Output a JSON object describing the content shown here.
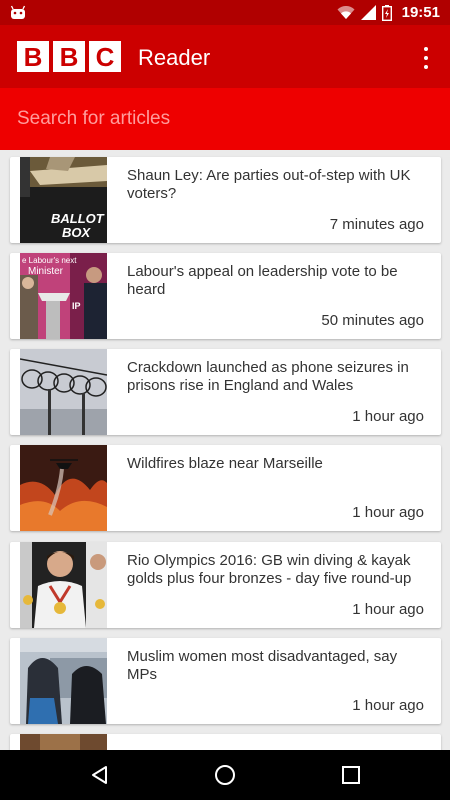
{
  "status_bar": {
    "time": "19:51",
    "icons": [
      "android-icon",
      "wifi-icon",
      "signal-icon",
      "battery-icon"
    ]
  },
  "app_bar": {
    "logo_letters": [
      "B",
      "B",
      "C"
    ],
    "title": "Reader",
    "menu_icon": "overflow-menu-icon"
  },
  "search": {
    "placeholder": "Search for articles",
    "value": ""
  },
  "articles": [
    {
      "headline": "Shaun Ley: Are parties out-of-step with UK voters?",
      "time": "7 minutes ago",
      "thumb_text": "BALLOT BOX"
    },
    {
      "headline": "Labour's appeal on leadership vote to be heard",
      "time": "50 minutes ago",
      "thumb_text": "e Labour's next Minister"
    },
    {
      "headline": "Crackdown launched as phone seizures in prisons rise in England and Wales",
      "time": "1 hour ago"
    },
    {
      "headline": "Wildfires blaze near Marseille",
      "time": "1 hour ago"
    },
    {
      "headline": "Rio Olympics 2016: GB win diving & kayak golds plus four bronzes - day five round-up",
      "time": "1 hour ago"
    },
    {
      "headline": "Muslim women most disadvantaged, say MPs",
      "time": "1 hour ago"
    }
  ],
  "nav_bar": {
    "buttons": [
      "back-icon",
      "home-icon",
      "recents-icon"
    ]
  },
  "colors": {
    "status_bar": "#b00000",
    "app_bar": "#cc0000",
    "search_bar": "#ee0000",
    "background": "#ebebeb"
  }
}
